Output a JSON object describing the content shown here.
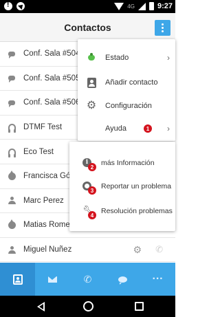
{
  "status_bar": {
    "network": "4G",
    "time": "9:27"
  },
  "header": {
    "title": "Contactos"
  },
  "contacts": [
    {
      "name": "Conf. Sala #504",
      "icon": "chat-icon"
    },
    {
      "name": "Conf. Sala #505",
      "icon": "chat-icon"
    },
    {
      "name": "Conf. Sala #506",
      "icon": "chat-icon"
    },
    {
      "name": "DTMF Test",
      "icon": "headset-icon"
    },
    {
      "name": "Eco Test",
      "icon": "headset-icon"
    },
    {
      "name": "Francisca Góm",
      "icon": "drop-icon"
    },
    {
      "name": "Marc Perez",
      "icon": "person-icon"
    },
    {
      "name": "Matias Romer",
      "icon": "drop-icon"
    },
    {
      "name": "Miguel Nuñez",
      "icon": "person-icon"
    }
  ],
  "menu": {
    "items": [
      {
        "label": "Estado",
        "icon": "status-icon",
        "has_submenu": true
      },
      {
        "label": "Añadir contacto",
        "icon": "add-contact-icon",
        "has_submenu": false
      },
      {
        "label": "Configuración",
        "icon": "gears-icon",
        "has_submenu": false
      },
      {
        "label": "Ayuda",
        "badge": "1",
        "has_submenu": true
      }
    ]
  },
  "help_submenu": {
    "items": [
      {
        "label": "más Información",
        "icon": "info-icon",
        "badge": "2"
      },
      {
        "label": "Reportar un problema",
        "icon": "lifebuoy-icon",
        "badge": "3"
      },
      {
        "label": "Resolución problemas",
        "icon": "wrench-icon",
        "badge": "4"
      }
    ]
  },
  "bottom_tabs": [
    {
      "icon": "contacts-tab-icon",
      "active": true
    },
    {
      "icon": "mail-tab-icon",
      "active": false
    },
    {
      "icon": "phone-tab-icon",
      "active": false
    },
    {
      "icon": "chat-tab-icon",
      "active": false
    },
    {
      "icon": "more-tab-icon",
      "active": false
    }
  ],
  "colors": {
    "accent": "#3ea7e8",
    "accent_active": "#2f8fd3",
    "badge": "#d4141e",
    "status_online": "#57c04a"
  }
}
